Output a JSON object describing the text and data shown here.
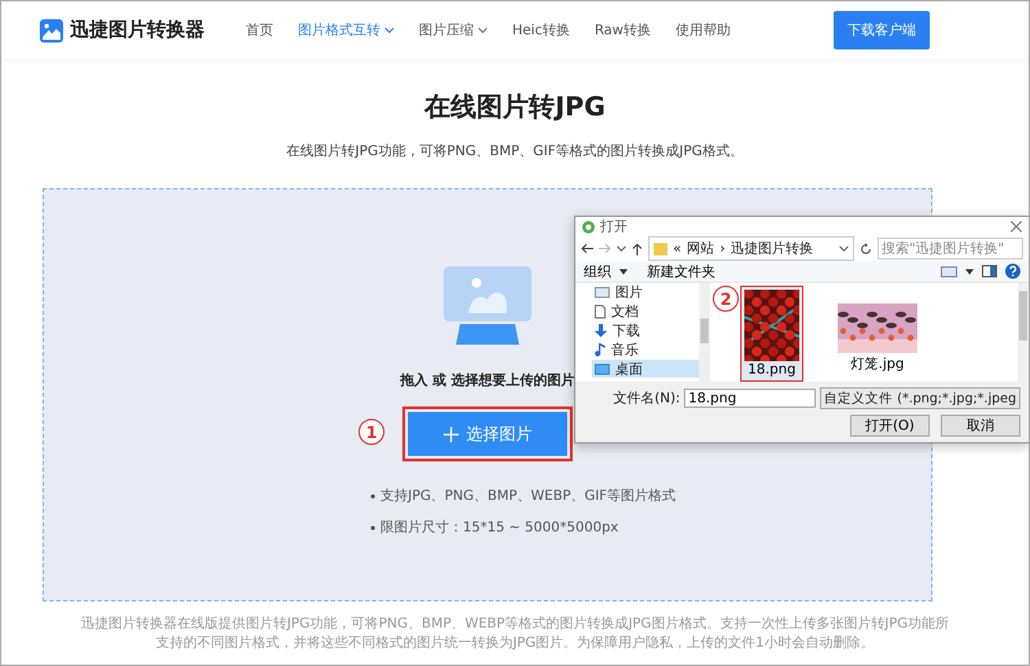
{
  "header": {
    "logo": "迅捷图片转换器",
    "nav": [
      {
        "label": "首页",
        "selected": false,
        "dropdown": false
      },
      {
        "label": "图片格式互转",
        "selected": true,
        "dropdown": true
      },
      {
        "label": "图片压缩",
        "selected": false,
        "dropdown": true
      },
      {
        "label": "Heic转换",
        "selected": false,
        "dropdown": false
      },
      {
        "label": "Raw转换",
        "selected": false,
        "dropdown": false
      },
      {
        "label": "使用帮助",
        "selected": false,
        "dropdown": false
      }
    ],
    "download_button": "下载客户端"
  },
  "title": "在线图片转JPG",
  "subtitle": "在线图片转JPG功能，可将PNG、BMP、GIF等格式的图片转换成JPG格式。",
  "upload": {
    "prompt": "拖入 或 选择想要上传的图片",
    "button": {
      "label": "选择图片",
      "highlighted": true,
      "step": "1"
    },
    "notes": [
      "支持JPG、PNG、BMP、WEBP、GIF等图片格式",
      "限图片尺寸：15*15 ~ 5000*5000px"
    ]
  },
  "dialog": {
    "title": "打开",
    "path": [
      "«",
      "网站",
      "›",
      "迅捷图片转换"
    ],
    "search": {
      "placeholder": "搜索\"迅捷图片转换\""
    },
    "toolbar": {
      "organize": "组织",
      "new_folder": "新建文件夹"
    },
    "tree": [
      {
        "label": "图片",
        "selected": false
      },
      {
        "label": "文档",
        "selected": false
      },
      {
        "label": "下载",
        "selected": false
      },
      {
        "label": "音乐",
        "selected": false
      },
      {
        "label": "桌面",
        "selected": true
      }
    ],
    "files": [
      {
        "name": "18.png",
        "selected": true,
        "highlighted": true,
        "step": "2",
        "kind": "picture"
      },
      {
        "name": "灯笼.jpg",
        "selected": false,
        "highlighted": false,
        "kind": "picture"
      }
    ],
    "filename_label": "文件名(N):",
    "filename": "18.png",
    "filter": "自定义文件 (*.png;*.jpg;*.jpeg",
    "buttons": [
      "打开(O)",
      "取消"
    ]
  },
  "footer": "迅捷图片转换器在线版提供图片转JPG功能，可将PNG、BMP、WEBP等格式的图片转换成JPG图片格式。支持一次性上传多张图片转JPG功能所支持的不同图片格式，并将这些不同格式的图片统一转换为JPG图片。为保障用户隐私，上传的文件1小时会自动删除。"
}
